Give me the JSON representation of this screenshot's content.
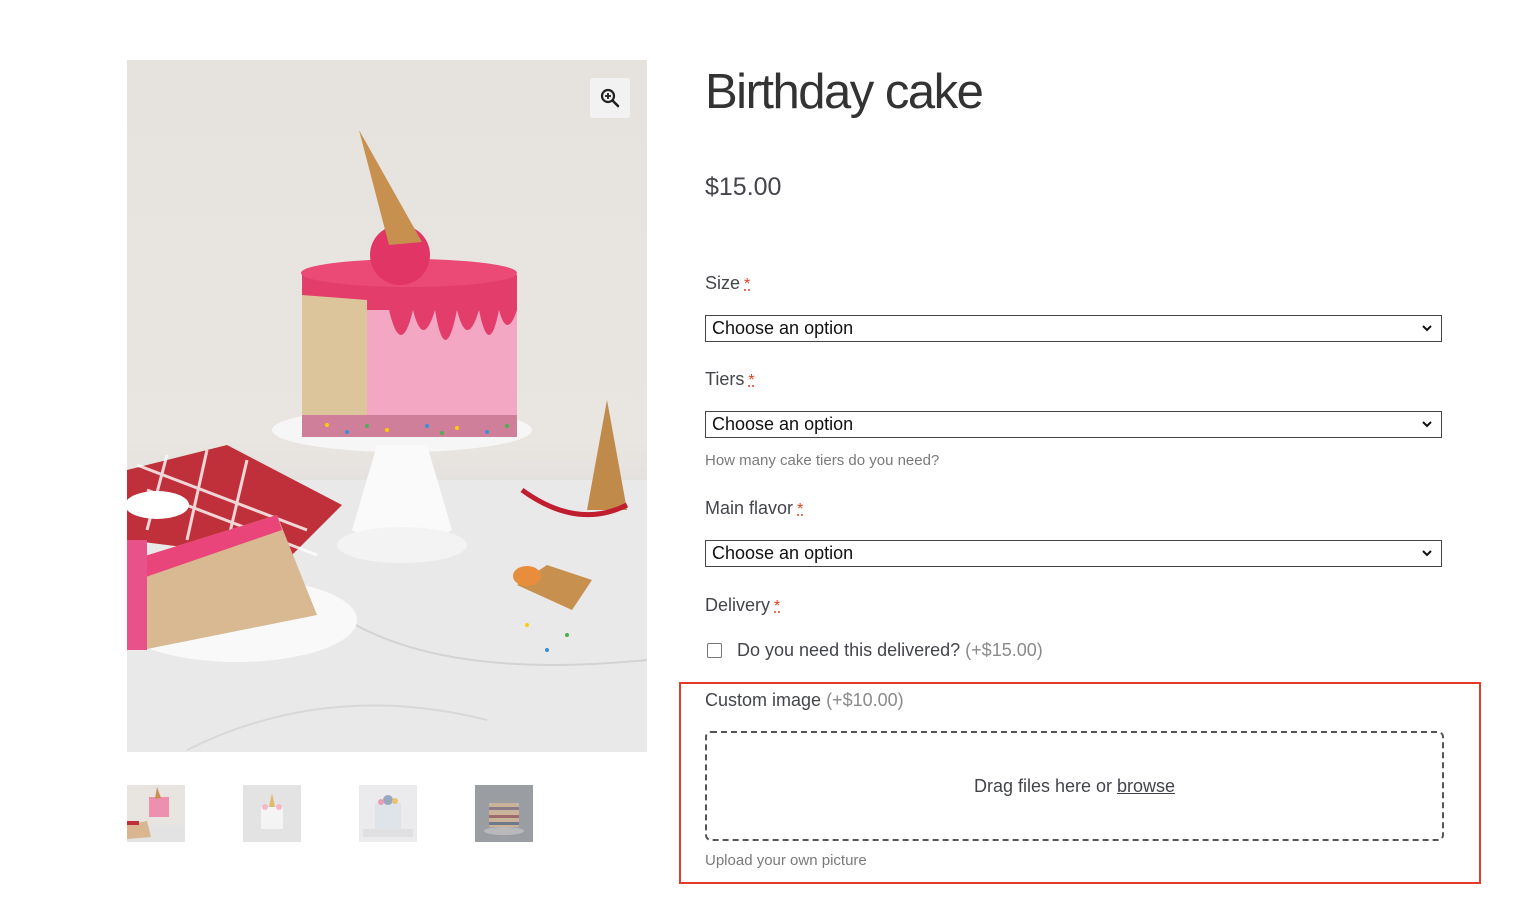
{
  "product": {
    "title": "Birthday cake",
    "price": "$15.00"
  },
  "gallery": {
    "zoom_icon": "zoom-in-icon",
    "thumbnails": [
      "cake-slice",
      "unicorn-cake",
      "blue-cake",
      "layer-cake"
    ]
  },
  "fields": {
    "size": {
      "label": "Size",
      "required_mark": "*",
      "selected": "Choose an option"
    },
    "tiers": {
      "label": "Tiers",
      "required_mark": "*",
      "selected": "Choose an option",
      "help": "How many cake tiers do you need?"
    },
    "flavor": {
      "label": "Main flavor",
      "required_mark": "*",
      "selected": "Choose an option"
    },
    "delivery": {
      "label": "Delivery",
      "required_mark": "*",
      "checkbox_label": "Do you need this delivered?",
      "checkbox_price": "(+$15.00)"
    },
    "custom_image": {
      "label": "Custom image",
      "price": "(+$10.00)",
      "drop_text": "Drag files here or",
      "browse": "browse",
      "help": "Upload your own picture"
    }
  },
  "colors": {
    "highlight": "#e33a2a",
    "required": "#e2401c"
  }
}
